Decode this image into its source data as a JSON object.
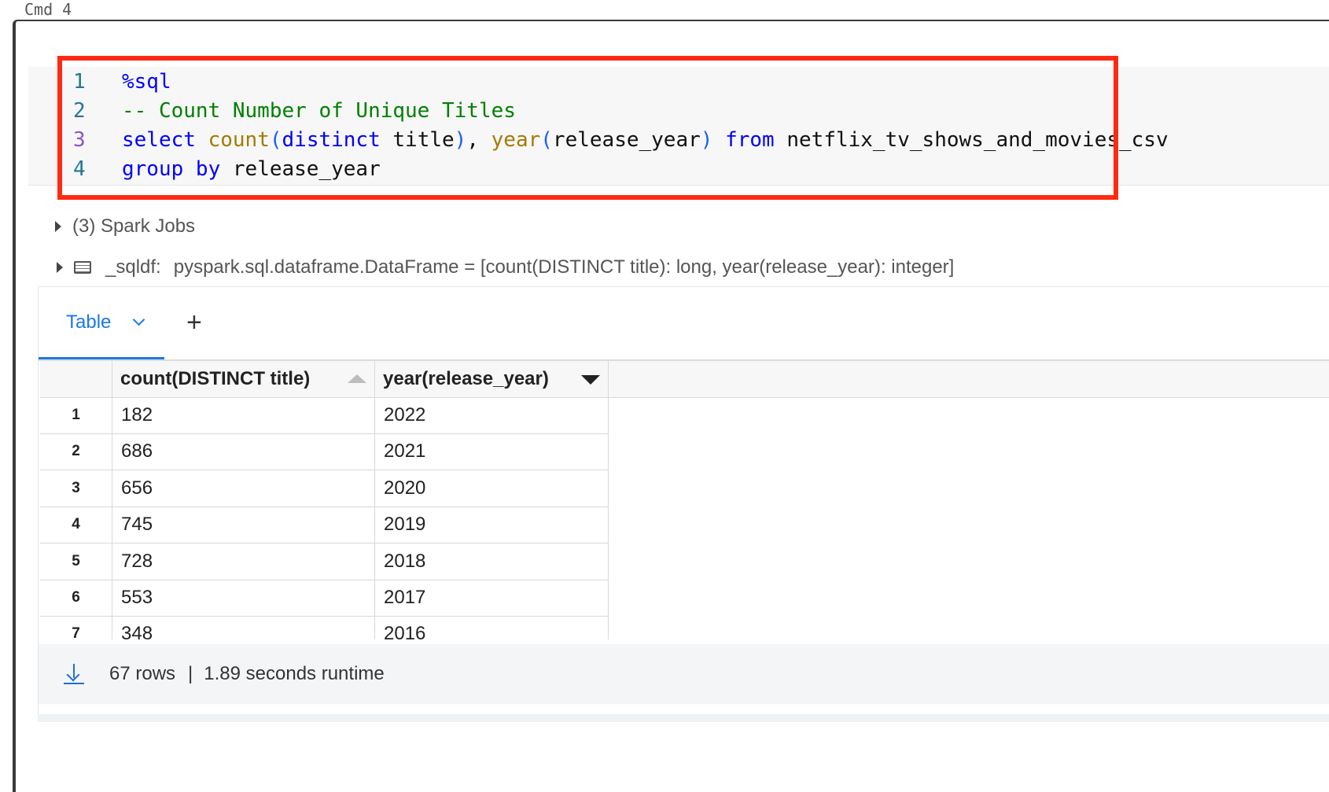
{
  "cell": {
    "label": "Cmd 4"
  },
  "code": {
    "lines": [
      {
        "num": "1",
        "tokens": {
          "a": "%sql"
        }
      },
      {
        "num": "2",
        "tokens": {
          "a": "-- Count Number of Unique Titles"
        }
      },
      {
        "num": "3",
        "tokens": {
          "a": "select ",
          "b": "count",
          "c": "(",
          "d": "distinct",
          "e": " title",
          "f": ")",
          "g": ", ",
          "h": "year",
          "i": "(",
          "j": "release_year",
          "k": ")",
          "l": " from",
          "m": " netflix_tv_shows_and_movies_csv"
        }
      },
      {
        "num": "4",
        "tokens": {
          "a": "group by",
          "b": " release_year"
        }
      }
    ]
  },
  "output": {
    "spark_jobs": "(3) Spark Jobs",
    "df_name": "_sqldf:",
    "df_schema": "pyspark.sql.dataframe.DataFrame = [count(DISTINCT title): long, year(release_year): integer]"
  },
  "results": {
    "tab_label": "Table",
    "add_label": "+",
    "columns": [
      "count(DISTINCT title)",
      "year(release_year)"
    ],
    "rows": [
      {
        "idx": "1",
        "count": "182",
        "year": "2022"
      },
      {
        "idx": "2",
        "count": "686",
        "year": "2021"
      },
      {
        "idx": "3",
        "count": "656",
        "year": "2020"
      },
      {
        "idx": "4",
        "count": "745",
        "year": "2019"
      },
      {
        "idx": "5",
        "count": "728",
        "year": "2018"
      },
      {
        "idx": "6",
        "count": "553",
        "year": "2017"
      },
      {
        "idx": "7",
        "count": "348",
        "year": "2016"
      }
    ],
    "footer": {
      "rows": "67 rows",
      "separator": "|",
      "runtime": "1.89 seconds runtime"
    }
  },
  "colors": {
    "highlight": "#ff2a12",
    "accent": "#1b78e6",
    "keyword": "#0000ff",
    "comment": "#008000",
    "function": "#a47a00"
  }
}
